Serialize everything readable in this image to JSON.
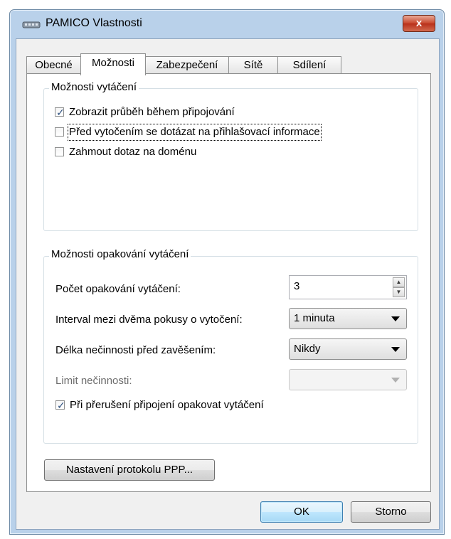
{
  "window": {
    "title": "PAMICO Vlastnosti",
    "close_label": "x"
  },
  "tabs": [
    {
      "label": "Obecné"
    },
    {
      "label": "Možnosti"
    },
    {
      "label": "Zabezpečení"
    },
    {
      "label": "Sítě"
    },
    {
      "label": "Sdílení"
    }
  ],
  "dialing": {
    "group_label": "Možnosti vytáčení",
    "options": [
      {
        "label": "Zobrazit průběh během připojování",
        "checked": true
      },
      {
        "label": "Před vytočením se dotázat na přihlašovací informace",
        "checked": false
      },
      {
        "label": "Zahmout dotaz na doménu",
        "checked": false
      }
    ]
  },
  "redial": {
    "group_label": "Možnosti opakování vytáčení",
    "attempts_label": "Počet opakování vytáčení:",
    "attempts_value": "3",
    "interval_label": "Interval mezi dvěma pokusy o vytočení:",
    "interval_value": "1 minuta",
    "idle_label": "Délka nečinnosti před zavěšením:",
    "idle_value": "Nikdy",
    "idle_limit_label": "Limit nečinnosti:",
    "idle_limit_value": "",
    "redial_on_drop_label": "Při přerušení připojení opakovat vytáčení",
    "redial_on_drop_checked": true
  },
  "ppp_button": "Nastavení protokolu PPP...",
  "footer": {
    "ok_label": "OK",
    "cancel_label": "Storno"
  }
}
